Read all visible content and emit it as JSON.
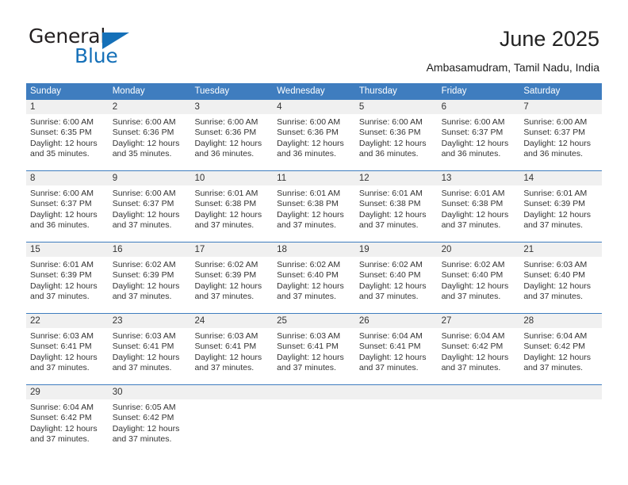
{
  "brand": {
    "name_dark": "General",
    "name_blue": "Blue",
    "dark_color": "#231f20",
    "blue_color": "#1570b8"
  },
  "header": {
    "title": "June 2025",
    "subtitle": "Ambasamudram, Tamil Nadu, India"
  },
  "theme": {
    "header_bg": "#3f7dbf",
    "header_text": "#ffffff",
    "daynum_bg": "#f0f0f0",
    "body_text": "#333333"
  },
  "weekdays": [
    "Sunday",
    "Monday",
    "Tuesday",
    "Wednesday",
    "Thursday",
    "Friday",
    "Saturday"
  ],
  "weeks": [
    [
      {
        "day": "1",
        "sunrise": "Sunrise: 6:00 AM",
        "sunset": "Sunset: 6:35 PM",
        "daylight": "Daylight: 12 hours and 35 minutes."
      },
      {
        "day": "2",
        "sunrise": "Sunrise: 6:00 AM",
        "sunset": "Sunset: 6:36 PM",
        "daylight": "Daylight: 12 hours and 35 minutes."
      },
      {
        "day": "3",
        "sunrise": "Sunrise: 6:00 AM",
        "sunset": "Sunset: 6:36 PM",
        "daylight": "Daylight: 12 hours and 36 minutes."
      },
      {
        "day": "4",
        "sunrise": "Sunrise: 6:00 AM",
        "sunset": "Sunset: 6:36 PM",
        "daylight": "Daylight: 12 hours and 36 minutes."
      },
      {
        "day": "5",
        "sunrise": "Sunrise: 6:00 AM",
        "sunset": "Sunset: 6:36 PM",
        "daylight": "Daylight: 12 hours and 36 minutes."
      },
      {
        "day": "6",
        "sunrise": "Sunrise: 6:00 AM",
        "sunset": "Sunset: 6:37 PM",
        "daylight": "Daylight: 12 hours and 36 minutes."
      },
      {
        "day": "7",
        "sunrise": "Sunrise: 6:00 AM",
        "sunset": "Sunset: 6:37 PM",
        "daylight": "Daylight: 12 hours and 36 minutes."
      }
    ],
    [
      {
        "day": "8",
        "sunrise": "Sunrise: 6:00 AM",
        "sunset": "Sunset: 6:37 PM",
        "daylight": "Daylight: 12 hours and 36 minutes."
      },
      {
        "day": "9",
        "sunrise": "Sunrise: 6:00 AM",
        "sunset": "Sunset: 6:37 PM",
        "daylight": "Daylight: 12 hours and 37 minutes."
      },
      {
        "day": "10",
        "sunrise": "Sunrise: 6:01 AM",
        "sunset": "Sunset: 6:38 PM",
        "daylight": "Daylight: 12 hours and 37 minutes."
      },
      {
        "day": "11",
        "sunrise": "Sunrise: 6:01 AM",
        "sunset": "Sunset: 6:38 PM",
        "daylight": "Daylight: 12 hours and 37 minutes."
      },
      {
        "day": "12",
        "sunrise": "Sunrise: 6:01 AM",
        "sunset": "Sunset: 6:38 PM",
        "daylight": "Daylight: 12 hours and 37 minutes."
      },
      {
        "day": "13",
        "sunrise": "Sunrise: 6:01 AM",
        "sunset": "Sunset: 6:38 PM",
        "daylight": "Daylight: 12 hours and 37 minutes."
      },
      {
        "day": "14",
        "sunrise": "Sunrise: 6:01 AM",
        "sunset": "Sunset: 6:39 PM",
        "daylight": "Daylight: 12 hours and 37 minutes."
      }
    ],
    [
      {
        "day": "15",
        "sunrise": "Sunrise: 6:01 AM",
        "sunset": "Sunset: 6:39 PM",
        "daylight": "Daylight: 12 hours and 37 minutes."
      },
      {
        "day": "16",
        "sunrise": "Sunrise: 6:02 AM",
        "sunset": "Sunset: 6:39 PM",
        "daylight": "Daylight: 12 hours and 37 minutes."
      },
      {
        "day": "17",
        "sunrise": "Sunrise: 6:02 AM",
        "sunset": "Sunset: 6:39 PM",
        "daylight": "Daylight: 12 hours and 37 minutes."
      },
      {
        "day": "18",
        "sunrise": "Sunrise: 6:02 AM",
        "sunset": "Sunset: 6:40 PM",
        "daylight": "Daylight: 12 hours and 37 minutes."
      },
      {
        "day": "19",
        "sunrise": "Sunrise: 6:02 AM",
        "sunset": "Sunset: 6:40 PM",
        "daylight": "Daylight: 12 hours and 37 minutes."
      },
      {
        "day": "20",
        "sunrise": "Sunrise: 6:02 AM",
        "sunset": "Sunset: 6:40 PM",
        "daylight": "Daylight: 12 hours and 37 minutes."
      },
      {
        "day": "21",
        "sunrise": "Sunrise: 6:03 AM",
        "sunset": "Sunset: 6:40 PM",
        "daylight": "Daylight: 12 hours and 37 minutes."
      }
    ],
    [
      {
        "day": "22",
        "sunrise": "Sunrise: 6:03 AM",
        "sunset": "Sunset: 6:41 PM",
        "daylight": "Daylight: 12 hours and 37 minutes."
      },
      {
        "day": "23",
        "sunrise": "Sunrise: 6:03 AM",
        "sunset": "Sunset: 6:41 PM",
        "daylight": "Daylight: 12 hours and 37 minutes."
      },
      {
        "day": "24",
        "sunrise": "Sunrise: 6:03 AM",
        "sunset": "Sunset: 6:41 PM",
        "daylight": "Daylight: 12 hours and 37 minutes."
      },
      {
        "day": "25",
        "sunrise": "Sunrise: 6:03 AM",
        "sunset": "Sunset: 6:41 PM",
        "daylight": "Daylight: 12 hours and 37 minutes."
      },
      {
        "day": "26",
        "sunrise": "Sunrise: 6:04 AM",
        "sunset": "Sunset: 6:41 PM",
        "daylight": "Daylight: 12 hours and 37 minutes."
      },
      {
        "day": "27",
        "sunrise": "Sunrise: 6:04 AM",
        "sunset": "Sunset: 6:42 PM",
        "daylight": "Daylight: 12 hours and 37 minutes."
      },
      {
        "day": "28",
        "sunrise": "Sunrise: 6:04 AM",
        "sunset": "Sunset: 6:42 PM",
        "daylight": "Daylight: 12 hours and 37 minutes."
      }
    ],
    [
      {
        "day": "29",
        "sunrise": "Sunrise: 6:04 AM",
        "sunset": "Sunset: 6:42 PM",
        "daylight": "Daylight: 12 hours and 37 minutes."
      },
      {
        "day": "30",
        "sunrise": "Sunrise: 6:05 AM",
        "sunset": "Sunset: 6:42 PM",
        "daylight": "Daylight: 12 hours and 37 minutes."
      },
      {
        "day": "",
        "sunrise": "",
        "sunset": "",
        "daylight": ""
      },
      {
        "day": "",
        "sunrise": "",
        "sunset": "",
        "daylight": ""
      },
      {
        "day": "",
        "sunrise": "",
        "sunset": "",
        "daylight": ""
      },
      {
        "day": "",
        "sunrise": "",
        "sunset": "",
        "daylight": ""
      },
      {
        "day": "",
        "sunrise": "",
        "sunset": "",
        "daylight": ""
      }
    ]
  ]
}
